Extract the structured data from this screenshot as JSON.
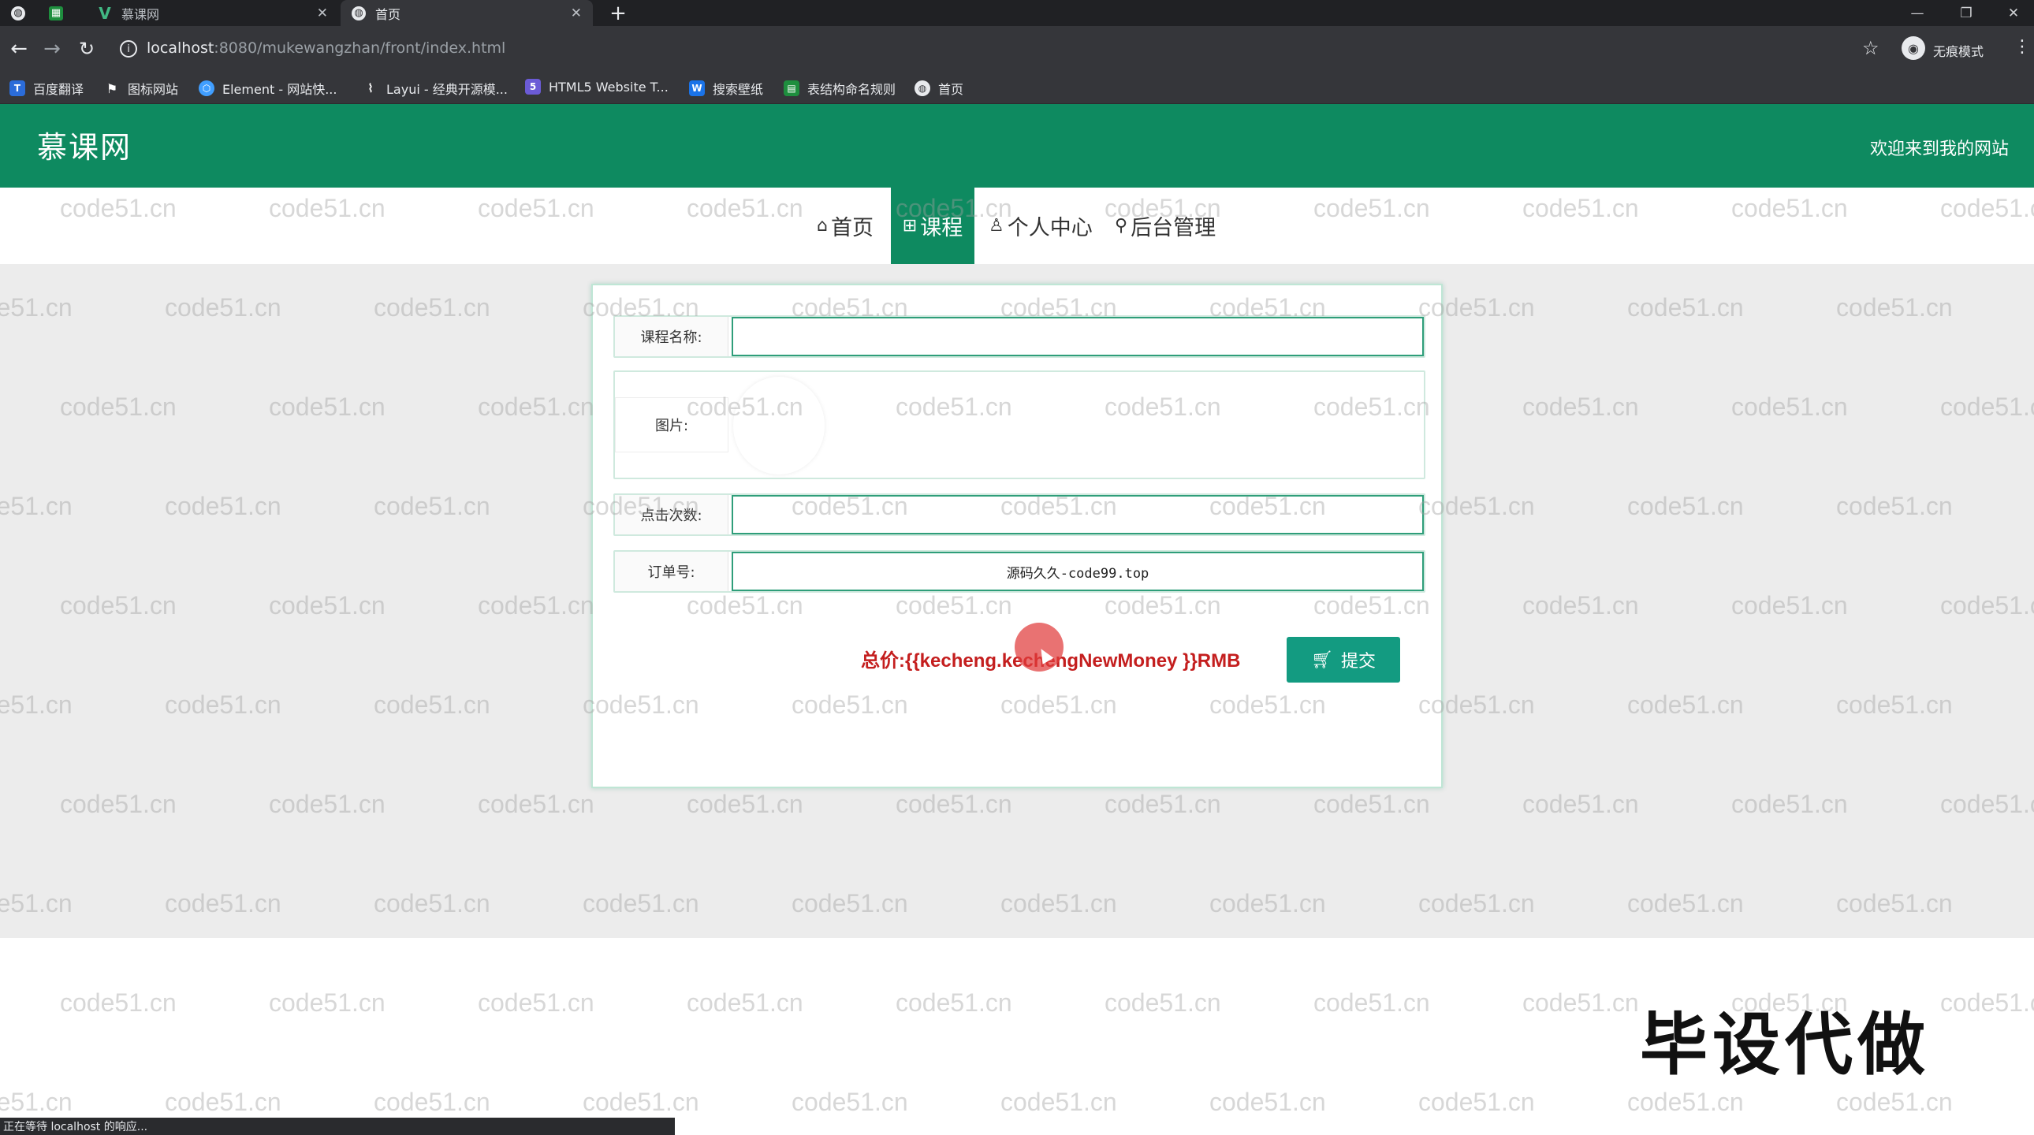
{
  "browser": {
    "tabs": [
      {
        "label": "",
        "icon": "globe-icon"
      },
      {
        "label": "",
        "icon": "spreadsheet-icon"
      },
      {
        "label": "慕课网",
        "icon": "vue-icon"
      },
      {
        "label": "首页",
        "icon": "globe-icon"
      }
    ],
    "url_host": "localhost",
    "url_path": ":8080/mukewangzhan/front/index.html",
    "profile_label": "无痕模式",
    "bookmarks": [
      {
        "label": "百度翻译",
        "icon": "translate-icon"
      },
      {
        "label": "图标网站",
        "icon": "flag-icon"
      },
      {
        "label": "Element - 网站快...",
        "icon": "element-icon"
      },
      {
        "label": "Layui - 经典开源模...",
        "icon": "layui-icon"
      },
      {
        "label": "HTML5 Website T...",
        "icon": "html5-icon"
      },
      {
        "label": "搜索壁纸",
        "icon": "wallpaper-icon"
      },
      {
        "label": "表结构命名规则",
        "icon": "table-icon"
      },
      {
        "label": "首页",
        "icon": "globe-icon"
      }
    ],
    "status_text": "正在等待 localhost 的响应..."
  },
  "site": {
    "logo": "慕课网",
    "welcome": "欢迎来到我的网站",
    "nav": [
      {
        "label": "首页",
        "icon": "home-icon",
        "active": false
      },
      {
        "label": "课程",
        "icon": "grid-icon",
        "active": true
      },
      {
        "label": "个人中心",
        "icon": "user-icon",
        "active": false
      },
      {
        "label": "后台管理",
        "icon": "link-icon",
        "active": false
      }
    ],
    "colors": {
      "brand": "#0e8a60",
      "button": "#139b81",
      "price": "#c41e1e"
    }
  },
  "form": {
    "course_name_label": "课程名称:",
    "course_name_value": "",
    "image_label": "图片:",
    "clicks_label": "点击次数:",
    "clicks_value": "",
    "order_label": "订单号:",
    "order_value": "源码久久-code99.top",
    "total_text": "总价:{{kecheng.kechengNewMoney }}RMB",
    "submit_label": "提交"
  },
  "overlay": {
    "watermark": "code51.cn",
    "bisheng": "毕设代做"
  }
}
